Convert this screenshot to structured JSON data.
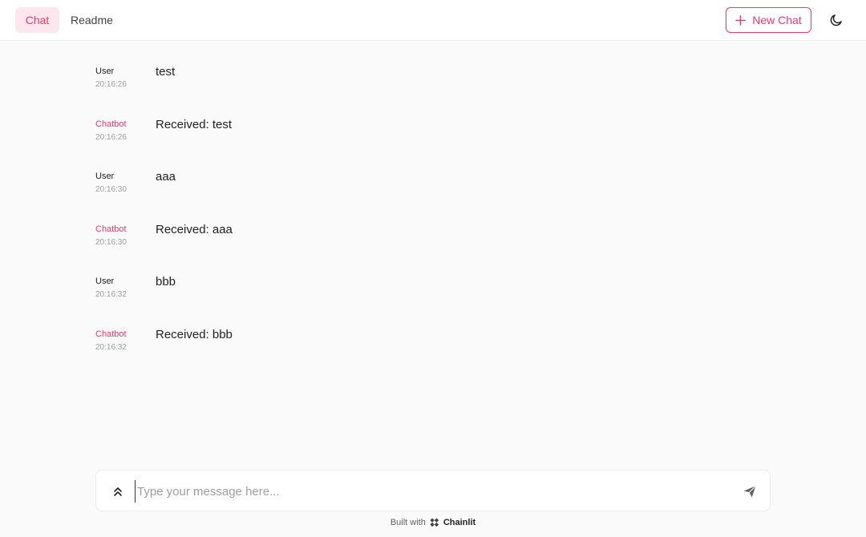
{
  "header": {
    "tabs": [
      {
        "label": "Chat",
        "active": true
      },
      {
        "label": "Readme",
        "active": false
      }
    ],
    "new_chat_label": "New Chat",
    "accent_color": "#f0386b"
  },
  "messages": [
    {
      "author": "User",
      "time": "20:16:26",
      "content": "test"
    },
    {
      "author": "Chatbot",
      "time": "20:16:26",
      "content": "Received: test"
    },
    {
      "author": "User",
      "time": "20:16:30",
      "content": "aaa"
    },
    {
      "author": "Chatbot",
      "time": "20:16:30",
      "content": "Received: aaa"
    },
    {
      "author": "User",
      "time": "20:16:32",
      "content": "bbb"
    },
    {
      "author": "Chatbot",
      "time": "20:16:32",
      "content": "Received: bbb"
    }
  ],
  "composer": {
    "placeholder": "Type your message here...",
    "value": ""
  },
  "footer": {
    "built_with": "Built with",
    "brand": "Chainlit"
  },
  "icons": {
    "new_chat": "plus-icon",
    "theme": "moon-icon",
    "expand": "chevrons-up-icon",
    "send": "send-icon",
    "brand": "chainlit-logo-icon"
  }
}
